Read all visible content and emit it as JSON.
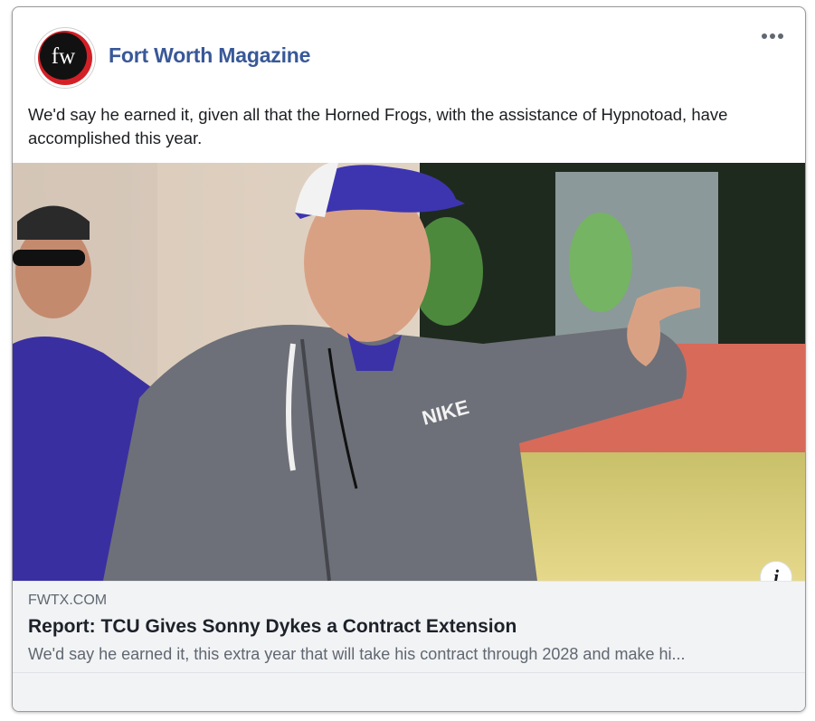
{
  "post": {
    "page_name": "Fort Worth Magazine",
    "avatar_text": "fw",
    "more_icon": "more-horizontal-icon",
    "caption": "We'd say he earned it, given all that the Horned Frogs, with the assistance of Hypnotoad, have accomplished this year."
  },
  "link_preview": {
    "domain": "FWTX.COM",
    "title": "Report: TCU Gives Sonny Dykes a Contract Extension",
    "description": "We'd say he earned it, this extra year that will take his contract through 2028 and make hi...",
    "info_icon": "info-icon",
    "info_glyph": "i"
  },
  "photo": {
    "jacket_logo": "NIKE"
  },
  "colors": {
    "brand_link": "#385898",
    "preview_bg": "#f2f3f5",
    "logo_red": "#d32027"
  }
}
